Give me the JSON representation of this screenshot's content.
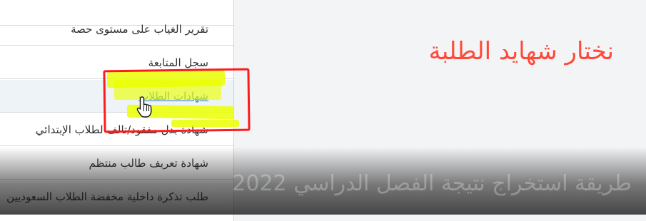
{
  "menu": {
    "items": [
      {
        "label": "تقرير الغياب على مستوى حصة"
      },
      {
        "label": "سجل المتابعة"
      },
      {
        "label": "شهادات الطلاب"
      },
      {
        "label": "شهادة بدل مفقود/تالف لطلاب الإبتدائي"
      },
      {
        "label": "شهادة تعريف طالب منتظم"
      },
      {
        "label": "طلب تذكرة داخلية مخفضة الطلاب السعوديين"
      }
    ]
  },
  "annotation": {
    "caption": "نختار شهايد الطلبة",
    "box_color": "#ff1b1b",
    "highlight_color": "#eaff00"
  },
  "watermark": {
    "text": "طريقة استخراج نتيجة الفصل الدراسي 2022"
  },
  "cursor": {
    "icon": "hand-pointer-icon"
  }
}
